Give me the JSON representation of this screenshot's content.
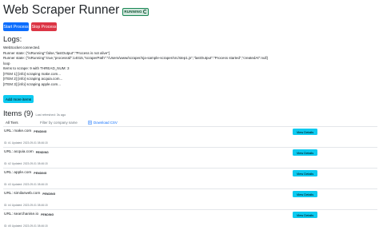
{
  "header": {
    "title": "Web Scraper Runner",
    "status_badge": "RUNNING"
  },
  "controls": {
    "start_label": "Start Process",
    "stop_label": "Stop Process"
  },
  "logs": {
    "title": "Logs:",
    "lines": [
      "WebSocket connected.",
      "Runner state: {\"isRunning\":false,\"lastOutput\":\"Process is not alive\"}",
      "Runner state: {\"isRunning\":true,\"processId\":14015,\"scraperPath\":\"/Users/www/scraper/nja-sample-scraper/src/step1.js\",\"lastOutput\":\"Process started\",\"createdAt\":null}",
      "loop",
      "Items to scrape: 9 with THREAD_NUM: 3",
      "[ITEM 1] [info] scraping make.com...",
      "[ITEM 2] [info] scraping acquia.com...",
      "[ITEM 3] [info] scraping apple.com..."
    ]
  },
  "add_items_label": "Add more items",
  "items_section": {
    "title": "Items (9)",
    "refreshed": "Last refreshed: 3s ago",
    "filter": {
      "tier_value": "All Tiers",
      "search_placeholder": "Filter by company name",
      "download_label": "Download CSV"
    },
    "rows": [
      {
        "url": "URL: make.com",
        "status": "PENDING",
        "meta": "ID: #1  Updated: 2023-09-01 08:46:15",
        "button": "View Details"
      },
      {
        "url": "URL: acquia.com",
        "status": "PENDING",
        "meta": "ID: #2  Updated: 2023-09-01 08:46:15",
        "button": "View Details"
      },
      {
        "url": "URL: apple.com",
        "status": "PENDING",
        "meta": "ID: #3  Updated: 2023-09-01 08:46:15",
        "button": "View Details"
      },
      {
        "url": "URL: similarweb.com",
        "status": "PENDING",
        "meta": "ID: #4  Updated: 2023-09-01 08:46:15",
        "button": "View Details"
      },
      {
        "url": "URL: searchanise.io",
        "status": "PENDING",
        "meta": "ID: #5  Updated: 2023-09-01 08:46:15",
        "button": "View Details"
      }
    ]
  },
  "colors": {
    "primary": "#0d6efd",
    "danger": "#dc3545",
    "info": "#0dcaf0",
    "success_bg": "#d1e7dd",
    "success_text": "#0f5132"
  }
}
